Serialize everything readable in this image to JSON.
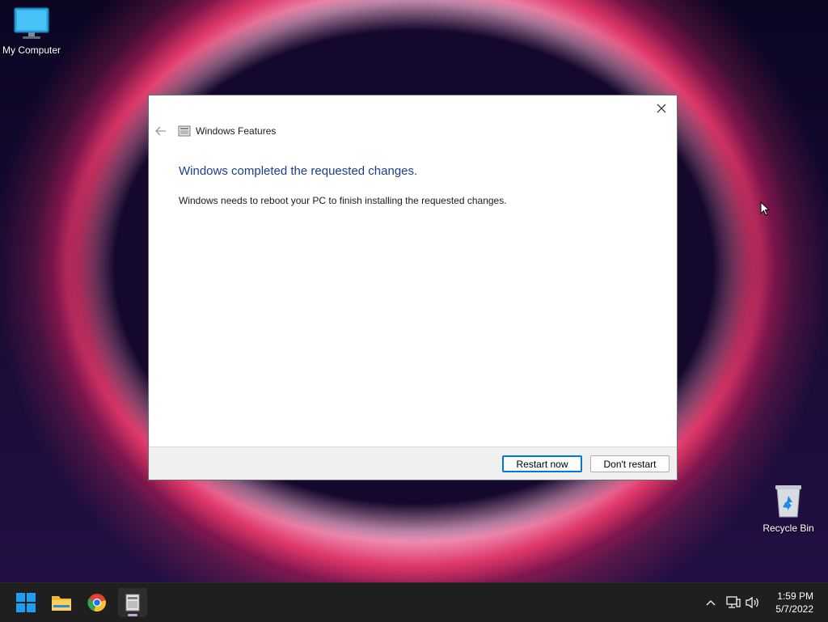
{
  "desktop": {
    "icons": [
      {
        "label": "My Computer",
        "icon": "monitor-icon"
      },
      {
        "label": "Recycle Bin",
        "icon": "recycle-bin-icon"
      }
    ]
  },
  "dialog": {
    "title": "Windows Features",
    "heading": "Windows completed the requested changes.",
    "message": "Windows needs to reboot your PC to finish installing the requested changes.",
    "buttons": {
      "restart_now": "Restart now",
      "dont_restart": "Don't restart"
    }
  },
  "taskbar": {
    "apps": [
      {
        "name": "start",
        "icon": "windows-logo-icon"
      },
      {
        "name": "file-explorer",
        "icon": "folder-icon"
      },
      {
        "name": "chrome",
        "icon": "chrome-icon"
      },
      {
        "name": "windows-features",
        "icon": "windows-features-icon",
        "active": true
      }
    ],
    "tray_icons": [
      "chevron-up-icon",
      "network-icon",
      "volume-icon"
    ],
    "time": "1:59 PM",
    "date": "5/7/2022"
  },
  "colors": {
    "heading": "#1b3f8b",
    "primary_border": "#0078d7",
    "taskbar": "#1f1f1f"
  }
}
